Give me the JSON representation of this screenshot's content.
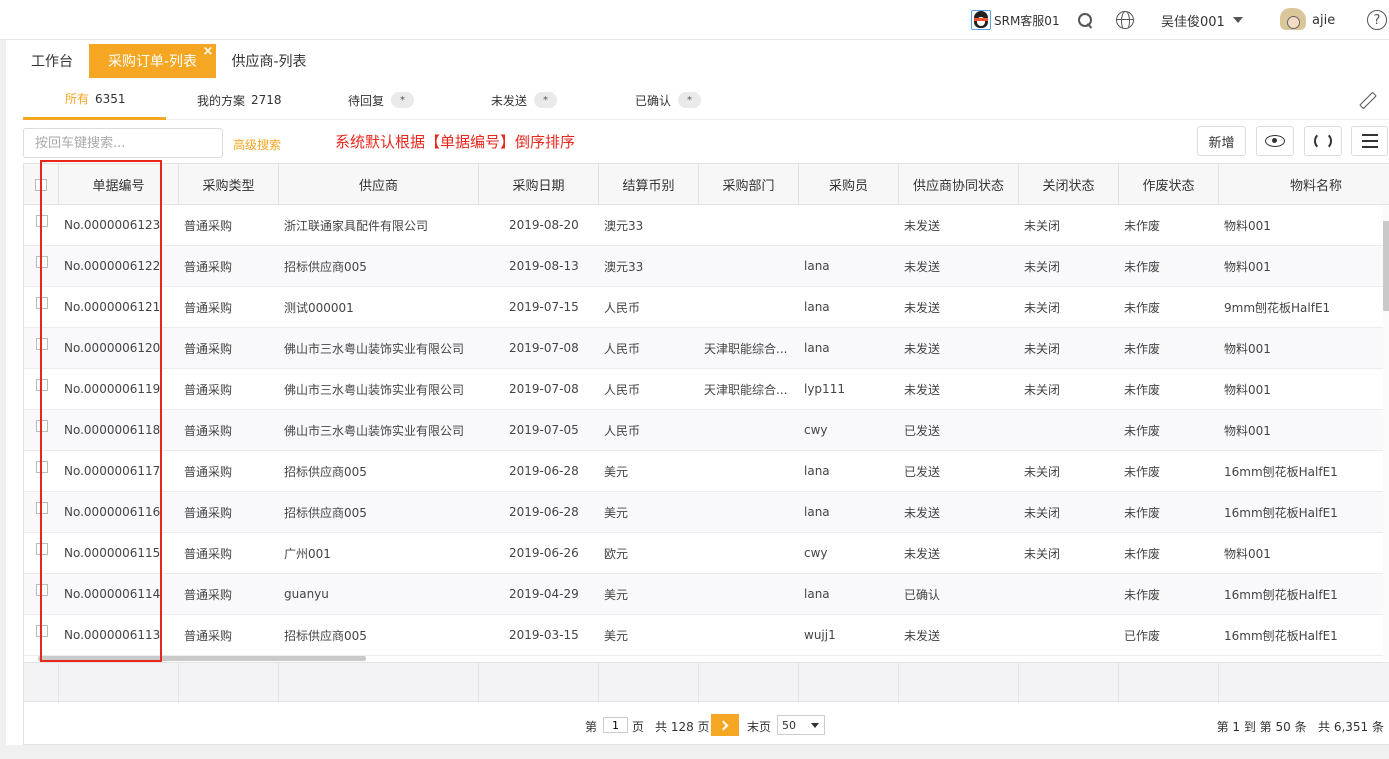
{
  "topbar": {
    "service": "SRM客服01",
    "user_cn": "吴佳俊001",
    "user": "ajie",
    "help": "?"
  },
  "page_tabs": [
    {
      "label": "工作台"
    },
    {
      "label": "采购订单-列表",
      "active": true,
      "close": "×"
    },
    {
      "label": "供应商-列表"
    }
  ],
  "status_tabs": [
    {
      "label": "所有",
      "count": "6351",
      "active": true
    },
    {
      "label": "我的方案",
      "count": "2718"
    },
    {
      "label": "待回复",
      "count": "*"
    },
    {
      "label": "未发送",
      "count": "*"
    },
    {
      "label": "已确认",
      "count": "*"
    }
  ],
  "toolbar": {
    "search_placeholder": "按回车键搜索...",
    "advanced_search": "高级搜索",
    "annotation": "系统默认根据【单据编号】倒序排序",
    "new_button": "新增"
  },
  "accent_color": "#f5a623",
  "annotation_color": "#e8271c",
  "columns": [
    "单据编号",
    "采购类型",
    "供应商",
    "采购日期",
    "结算币别",
    "采购部门",
    "采购员",
    "供应商协同状态",
    "关闭状态",
    "作废状态",
    "物料名称"
  ],
  "rows": [
    [
      "No.0000006123",
      "普通采购",
      "浙江联通家具配件有限公司",
      "2019-08-20",
      "澳元33",
      "",
      "",
      "未发送",
      "未关闭",
      "未作废",
      "物料001"
    ],
    [
      "No.0000006122",
      "普通采购",
      "招标供应商005",
      "2019-08-13",
      "澳元33",
      "",
      "lana",
      "未发送",
      "未关闭",
      "未作废",
      "物料001"
    ],
    [
      "No.0000006121",
      "普通采购",
      "测试000001",
      "2019-07-15",
      "人民币",
      "",
      "lana",
      "未发送",
      "未关闭",
      "未作废",
      "9mm刨花板HalfE1"
    ],
    [
      "No.0000006120",
      "普通采购",
      "佛山市三水粤山装饰实业有限公司",
      "2019-07-08",
      "人民币",
      "天津职能综合...",
      "lana",
      "未发送",
      "未关闭",
      "未作废",
      "物料001"
    ],
    [
      "No.0000006119",
      "普通采购",
      "佛山市三水粤山装饰实业有限公司",
      "2019-07-08",
      "人民币",
      "天津职能综合...",
      "lyp111",
      "未发送",
      "未关闭",
      "未作废",
      "物料001"
    ],
    [
      "No.0000006118",
      "普通采购",
      "佛山市三水粤山装饰实业有限公司",
      "2019-07-05",
      "人民币",
      "",
      "cwy",
      "已发送",
      "",
      "未作废",
      "物料001"
    ],
    [
      "No.0000006117",
      "普通采购",
      "招标供应商005",
      "2019-06-28",
      "美元",
      "",
      "lana",
      "已发送",
      "未关闭",
      "未作废",
      "16mm刨花板HalfE1"
    ],
    [
      "No.0000006116",
      "普通采购",
      "招标供应商005",
      "2019-06-28",
      "美元",
      "",
      "lana",
      "未发送",
      "未关闭",
      "未作废",
      "16mm刨花板HalfE1"
    ],
    [
      "No.0000006115",
      "普通采购",
      "广州001",
      "2019-06-26",
      "欧元",
      "",
      "cwy",
      "未发送",
      "未关闭",
      "未作废",
      "物料001"
    ],
    [
      "No.0000006114",
      "普通采购",
      "guanyu",
      "2019-04-29",
      "美元",
      "",
      "lana",
      "已确认",
      "",
      "未作废",
      "16mm刨花板HalfE1"
    ],
    [
      "No.0000006113",
      "普通采购",
      "招标供应商005",
      "2019-03-15",
      "美元",
      "",
      "wujj1",
      "未发送",
      "",
      "已作废",
      "16mm刨花板HalfE1"
    ]
  ],
  "pager": {
    "page_prefix": "第",
    "current_page": "1",
    "page_suffix": "页",
    "total_pages": "共 128 页",
    "last_page": "末页",
    "page_size": "50",
    "summary": "第 1 到 第 50 条   共 6,351 条"
  }
}
